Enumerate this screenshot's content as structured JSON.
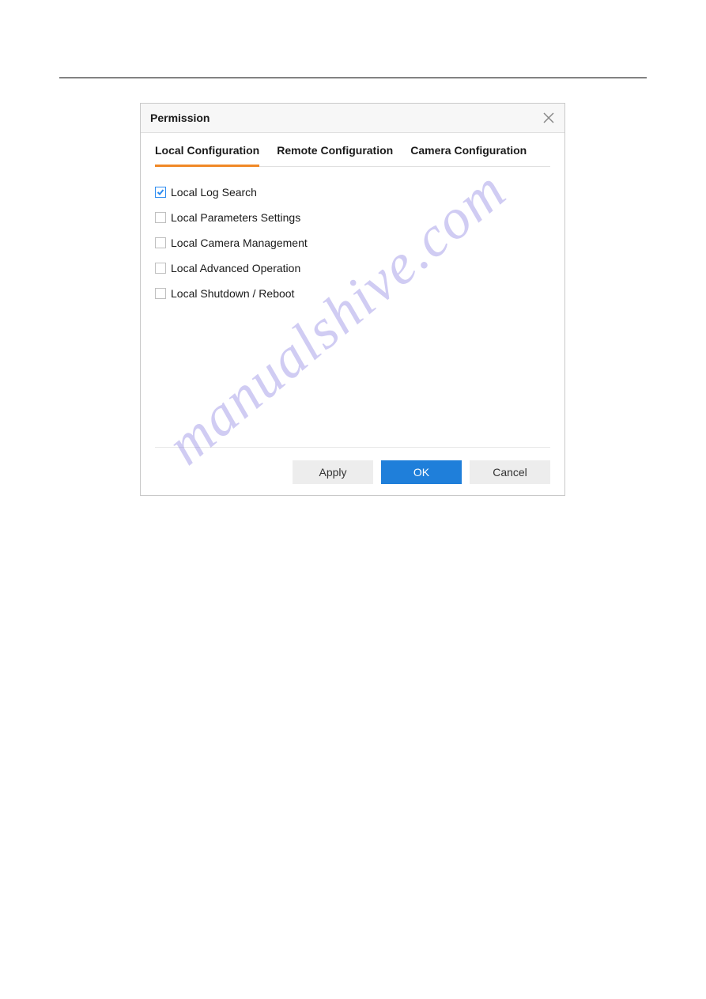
{
  "watermark_text": "manualshive.com",
  "dialog": {
    "title": "Permission",
    "tabs": [
      {
        "label": "Local Configuration"
      },
      {
        "label": "Remote Configuration"
      },
      {
        "label": "Camera Configuration"
      }
    ],
    "checkboxes": [
      {
        "label": "Local Log Search"
      },
      {
        "label": "Local Parameters Settings"
      },
      {
        "label": "Local Camera Management"
      },
      {
        "label": "Local Advanced Operation"
      },
      {
        "label": "Local Shutdown / Reboot"
      }
    ],
    "buttons": {
      "apply": "Apply",
      "ok": "OK",
      "cancel": "Cancel"
    }
  }
}
